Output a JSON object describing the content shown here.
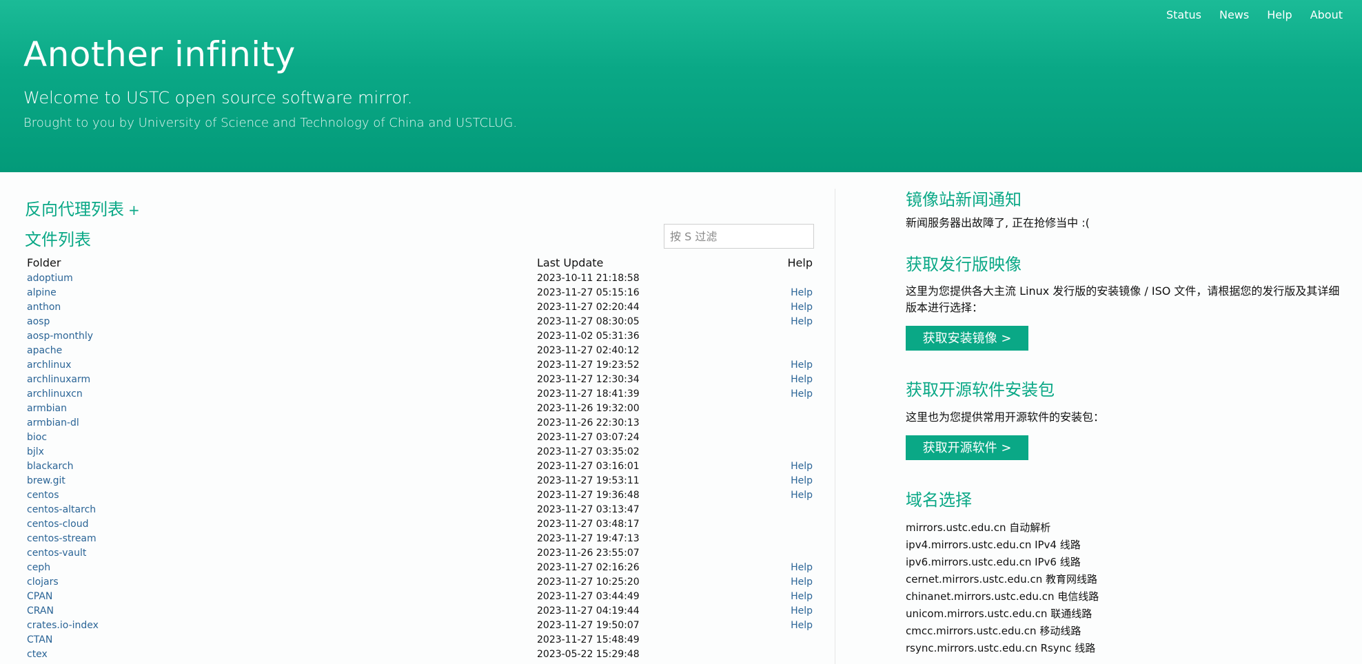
{
  "nav": [
    {
      "label": "Status"
    },
    {
      "label": "News"
    },
    {
      "label": "Help"
    },
    {
      "label": "About"
    }
  ],
  "hero": {
    "title": "Another infinity",
    "subtitle": "Welcome to USTC open source software mirror.",
    "subtitle2": "Brought to you by University of Science and Technology of China and USTCLUG."
  },
  "left": {
    "proxy_title": "反向代理列表",
    "proxy_plus": "+",
    "files_title": "文件列表",
    "filter_placeholder": "按 S 过滤",
    "columns": {
      "folder": "Folder",
      "update": "Last Update",
      "help": "Help"
    },
    "rows": [
      {
        "name": "adoptium",
        "update": "2023-10-11 21:18:58",
        "help": ""
      },
      {
        "name": "alpine",
        "update": "2023-11-27 05:15:16",
        "help": "Help"
      },
      {
        "name": "anthon",
        "update": "2023-11-27 02:20:44",
        "help": "Help"
      },
      {
        "name": "aosp",
        "update": "2023-11-27 08:30:05",
        "help": "Help"
      },
      {
        "name": "aosp-monthly",
        "update": "2023-11-02 05:31:36",
        "help": ""
      },
      {
        "name": "apache",
        "update": "2023-11-27 02:40:12",
        "help": ""
      },
      {
        "name": "archlinux",
        "update": "2023-11-27 19:23:52",
        "help": "Help"
      },
      {
        "name": "archlinuxarm",
        "update": "2023-11-27 12:30:34",
        "help": "Help"
      },
      {
        "name": "archlinuxcn",
        "update": "2023-11-27 18:41:39",
        "help": "Help"
      },
      {
        "name": "armbian",
        "update": "2023-11-26 19:32:00",
        "help": ""
      },
      {
        "name": "armbian-dl",
        "update": "2023-11-26 22:30:13",
        "help": ""
      },
      {
        "name": "bioc",
        "update": "2023-11-27 03:07:24",
        "help": ""
      },
      {
        "name": "bjlx",
        "update": "2023-11-27 03:35:02",
        "help": ""
      },
      {
        "name": "blackarch",
        "update": "2023-11-27 03:16:01",
        "help": "Help"
      },
      {
        "name": "brew.git",
        "update": "2023-11-27 19:53:11",
        "help": "Help"
      },
      {
        "name": "centos",
        "update": "2023-11-27 19:36:48",
        "help": "Help"
      },
      {
        "name": "centos-altarch",
        "update": "2023-11-27 03:13:47",
        "help": ""
      },
      {
        "name": "centos-cloud",
        "update": "2023-11-27 03:48:17",
        "help": ""
      },
      {
        "name": "centos-stream",
        "update": "2023-11-27 19:47:13",
        "help": ""
      },
      {
        "name": "centos-vault",
        "update": "2023-11-26 23:55:07",
        "help": ""
      },
      {
        "name": "ceph",
        "update": "2023-11-27 02:16:26",
        "help": "Help"
      },
      {
        "name": "clojars",
        "update": "2023-11-27 10:25:20",
        "help": "Help"
      },
      {
        "name": "CPAN",
        "update": "2023-11-27 03:44:49",
        "help": "Help"
      },
      {
        "name": "CRAN",
        "update": "2023-11-27 04:19:44",
        "help": "Help"
      },
      {
        "name": "crates.io-index",
        "update": "2023-11-27 19:50:07",
        "help": "Help"
      },
      {
        "name": "CTAN",
        "update": "2023-11-27 15:48:49",
        "help": ""
      },
      {
        "name": "ctex",
        "update": "2023-05-22 15:29:48",
        "help": ""
      }
    ]
  },
  "right": {
    "news_title": "镜像站新闻通知",
    "news_text": "新闻服务器出故障了, 正在抢修当中 :(",
    "distro_title": "获取发行版映像",
    "distro_text": "这里为您提供各大主流 Linux 发行版的安装镜像 / ISO 文件，请根据您的发行版及其详细版本进行选择：",
    "distro_button": "获取安装镜像 >",
    "software_title": "获取开源软件安装包",
    "software_text": "这里也为您提供常用开源软件的安装包：",
    "software_button": "获取开源软件 >",
    "domain_title": "域名选择",
    "domains": [
      "mirrors.ustc.edu.cn 自动解析",
      "ipv4.mirrors.ustc.edu.cn IPv4 线路",
      "ipv6.mirrors.ustc.edu.cn IPv6 线路",
      "cernet.mirrors.ustc.edu.cn 教育网线路",
      "chinanet.mirrors.ustc.edu.cn 电信线路",
      "unicom.mirrors.ustc.edu.cn 联通线路",
      "cmcc.mirrors.ustc.edu.cn 移动线路",
      "rsync.mirrors.ustc.edu.cn Rsync 线路"
    ]
  },
  "colors": {
    "brand": "#0aa886",
    "link": "#2a6496"
  }
}
